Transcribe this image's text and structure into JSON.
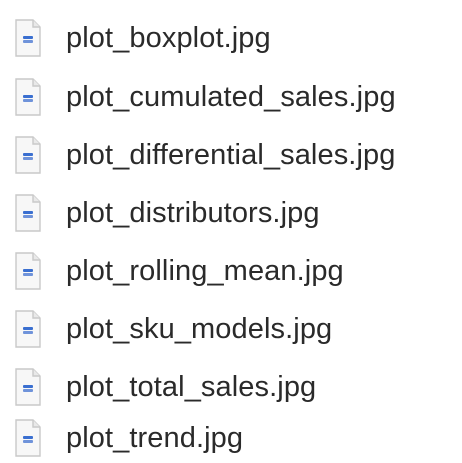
{
  "files": [
    {
      "name": "plot_boxplot.jpg",
      "icon": "jpg-file-icon"
    },
    {
      "name": "plot_cumulated_sales.jpg",
      "icon": "jpg-file-icon"
    },
    {
      "name": "plot_differential_sales.jpg",
      "icon": "jpg-file-icon"
    },
    {
      "name": "plot_distributors.jpg",
      "icon": "jpg-file-icon"
    },
    {
      "name": "plot_rolling_mean.jpg",
      "icon": "jpg-file-icon"
    },
    {
      "name": "plot_sku_models.jpg",
      "icon": "jpg-file-icon"
    },
    {
      "name": "plot_total_sales.jpg",
      "icon": "jpg-file-icon"
    },
    {
      "name": "plot_trend.jpg",
      "icon": "jpg-file-icon"
    }
  ],
  "colors": {
    "text": "#2a2a2a",
    "icon_page": "#f7f7f7",
    "icon_border": "#c9c9c9",
    "icon_accent": "#3a6fd0"
  }
}
